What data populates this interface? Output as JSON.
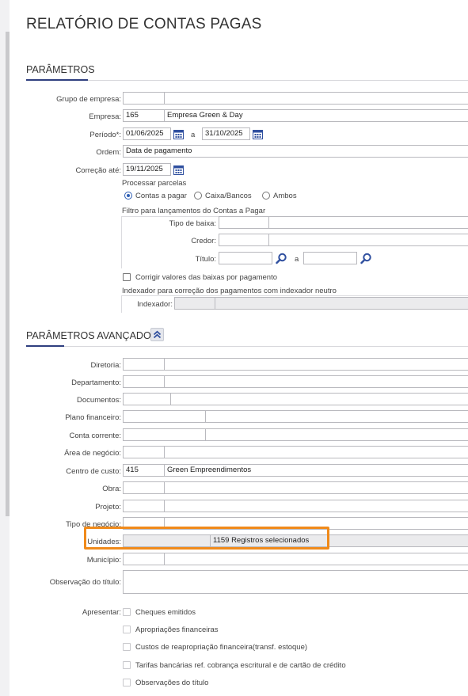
{
  "title": "RELATÓRIO DE CONTAS PAGAS",
  "sections": {
    "params": "PARÂMETROS",
    "advanced": "PARÂMETROS AVANÇADOS"
  },
  "fields": {
    "grupo_empresa": {
      "label": "Grupo de empresa:",
      "code": "",
      "desc": ""
    },
    "empresa": {
      "label": "Empresa:",
      "code": "165",
      "desc": "Empresa Green & Day"
    },
    "periodo": {
      "label": "Período*:",
      "start": "01/06/2025",
      "sep": "a",
      "end": "31/10/2025"
    },
    "ordem": {
      "label": "Ordem:",
      "value": "Data de pagamento"
    },
    "correcao": {
      "label": "Correção até:",
      "value": "19/11/2025"
    }
  },
  "processar": {
    "label": "Processar parcelas",
    "options": [
      "Contas a pagar",
      "Caixa/Bancos",
      "Ambos"
    ],
    "selected": "Contas a pagar"
  },
  "filtro": {
    "label": "Filtro para lançamentos do Contas a Pagar",
    "tipo_baixa": "Tipo de baixa:",
    "credor": "Credor:",
    "titulo": "Título:",
    "titulo_sep": "a"
  },
  "corrigir": {
    "label": "Corrigir valores das baixas por pagamento",
    "checked": false
  },
  "indexador": {
    "group_label": "Indexador para correção dos pagamentos com indexador neutro",
    "label": "Indexador:"
  },
  "advanced_fields": {
    "diretoria": "Diretoria:",
    "departamento": "Departamento:",
    "documentos": "Documentos:",
    "plano_financeiro": "Plano financeiro:",
    "conta_corrente": "Conta corrente:",
    "area_negocio": "Área de negócio:",
    "centro_custo": {
      "label": "Centro de custo:",
      "code": "415",
      "desc": "Green Empreendimentos"
    },
    "obra": "Obra:",
    "projeto": "Projeto:",
    "tipo_negocio": "Tipo de negócio:",
    "unidades": {
      "label": "Unidades:",
      "value": "1159 Registros selecionados"
    },
    "municipio": "Município:",
    "observacao": "Observação do título:"
  },
  "apresentar": {
    "label": "Apresentar:",
    "options": [
      "Cheques emitidos",
      "Apropriações financeiras",
      "Custos de reapropriação financeira(transf. estoque)",
      "Tarifas bancárias ref. cobrança escritural e de cartão de crédito",
      "Observações do título"
    ]
  },
  "colors": {
    "accent": "#2f3f7f",
    "highlight": "#f08a1a",
    "icon_blue": "#2f4f9f"
  }
}
